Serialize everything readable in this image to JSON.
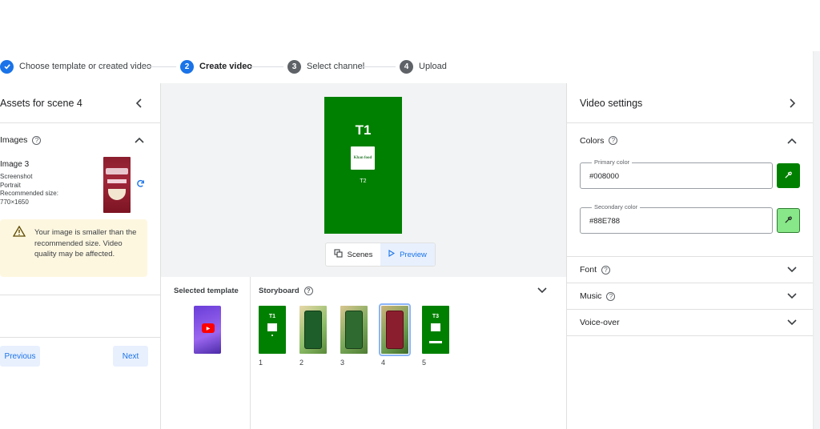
{
  "stepper": {
    "steps": [
      {
        "label": "Choose template or created video",
        "state": "done"
      },
      {
        "label": "Create video",
        "number": "2",
        "state": "active"
      },
      {
        "label": "Select channel",
        "number": "3",
        "state": "idle"
      },
      {
        "label": "Upload",
        "number": "4",
        "state": "idle"
      }
    ]
  },
  "left": {
    "title": "Assets for scene 4",
    "images_label": "Images",
    "image_name": "Image 3",
    "image_meta": [
      "Screenshot",
      "Portrait",
      "Recommended size:",
      "770×1650"
    ],
    "warning": "Your image is smaller than the recommended size. Video quality may be affected.",
    "previous": "Previous",
    "next": "Next"
  },
  "preview": {
    "title_text": "T1",
    "logo_text": "Khan food",
    "subtitle_text": "T2",
    "scenes_label": "Scenes",
    "preview_label": "Preview"
  },
  "bottom": {
    "selected_template_label": "Selected template",
    "storyboard_label": "Storyboard",
    "scenes": [
      {
        "num": "1",
        "kind": "green",
        "text": "T1"
      },
      {
        "num": "2",
        "kind": "photo",
        "text": ""
      },
      {
        "num": "3",
        "kind": "photo",
        "text": ""
      },
      {
        "num": "4",
        "kind": "photo",
        "text": ""
      },
      {
        "num": "5",
        "kind": "green",
        "text": "T3"
      }
    ]
  },
  "right": {
    "title": "Video settings",
    "colors_label": "Colors",
    "primary_label": "Primary color",
    "primary_value": "#008000",
    "secondary_label": "Secondary color",
    "secondary_value": "#88E788",
    "font_label": "Font",
    "music_label": "Music",
    "voiceover_label": "Voice-over"
  },
  "colors": {
    "accent": "#1a73e8",
    "primary": "#008000",
    "secondary": "#88E788",
    "warning_bg": "#fef7e0"
  }
}
